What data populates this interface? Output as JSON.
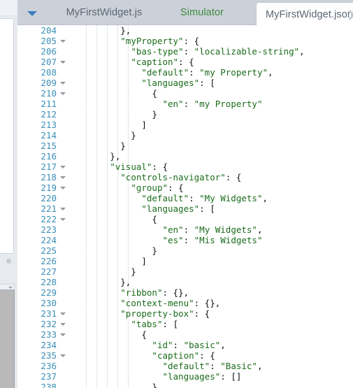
{
  "window": {
    "title": "MyFirstWidget.json"
  },
  "tabbar": {
    "dropdown_icon": "chevron-down-icon",
    "close_icon": "close-icon",
    "tabs": [
      {
        "label": "MyFirstWidget.js",
        "active": false
      },
      {
        "label": "Simulator",
        "active": false
      },
      {
        "label": "MyFirstWidget.json",
        "active": true
      }
    ]
  },
  "colors": {
    "tabbar_background": "#ccd1d9",
    "active_tab_background": "#ffffff",
    "editor_background": "#ffffff",
    "line_number": "#3a8fb7",
    "json_string": "#1a6b1a",
    "punctuation": "#111111",
    "simulator_tab_text": "#3f8a3f",
    "dropdown_caret": "#3a7fc1",
    "fold_marker": "#8f98a1"
  },
  "editor": {
    "language": "json",
    "first_line": 204,
    "last_line": 238,
    "lines": [
      {
        "n": 204,
        "fold": false,
        "text": "          },"
      },
      {
        "n": 205,
        "fold": true,
        "text": "          \"myProperty\": {"
      },
      {
        "n": 206,
        "fold": false,
        "text": "            \"bas-type\": \"localizable-string\","
      },
      {
        "n": 207,
        "fold": true,
        "text": "            \"caption\": {"
      },
      {
        "n": 208,
        "fold": false,
        "text": "              \"default\": \"my Property\","
      },
      {
        "n": 209,
        "fold": true,
        "text": "              \"languages\": ["
      },
      {
        "n": 210,
        "fold": true,
        "text": "                {"
      },
      {
        "n": 211,
        "fold": false,
        "text": "                  \"en\": \"my Property\""
      },
      {
        "n": 212,
        "fold": false,
        "text": "                }"
      },
      {
        "n": 213,
        "fold": false,
        "text": "              ]"
      },
      {
        "n": 214,
        "fold": false,
        "text": "            }"
      },
      {
        "n": 215,
        "fold": false,
        "text": "          }"
      },
      {
        "n": 216,
        "fold": false,
        "text": "        },"
      },
      {
        "n": 217,
        "fold": true,
        "text": "        \"visual\": {"
      },
      {
        "n": 218,
        "fold": true,
        "text": "          \"controls-navigator\": {"
      },
      {
        "n": 219,
        "fold": true,
        "text": "            \"group\": {"
      },
      {
        "n": 220,
        "fold": false,
        "text": "              \"default\": \"My Widgets\","
      },
      {
        "n": 221,
        "fold": true,
        "text": "              \"languages\": ["
      },
      {
        "n": 222,
        "fold": true,
        "text": "                {"
      },
      {
        "n": 223,
        "fold": false,
        "text": "                  \"en\": \"My Widgets\","
      },
      {
        "n": 224,
        "fold": false,
        "text": "                  \"es\": \"Mis Widgets\""
      },
      {
        "n": 225,
        "fold": false,
        "text": "                }"
      },
      {
        "n": 226,
        "fold": false,
        "text": "              ]"
      },
      {
        "n": 227,
        "fold": false,
        "text": "            }"
      },
      {
        "n": 228,
        "fold": false,
        "text": "          },"
      },
      {
        "n": 229,
        "fold": false,
        "text": "          \"ribbon\": {},"
      },
      {
        "n": 230,
        "fold": false,
        "text": "          \"context-menu\": {},"
      },
      {
        "n": 231,
        "fold": true,
        "text": "          \"property-box\": {"
      },
      {
        "n": 232,
        "fold": true,
        "text": "            \"tabs\": ["
      },
      {
        "n": 233,
        "fold": true,
        "text": "              {"
      },
      {
        "n": 234,
        "fold": false,
        "text": "                \"id\": \"basic\","
      },
      {
        "n": 235,
        "fold": true,
        "text": "                \"caption\": {"
      },
      {
        "n": 236,
        "fold": false,
        "text": "                  \"default\": \"Basic\","
      },
      {
        "n": 237,
        "fold": false,
        "text": "                  \"languages\": []"
      },
      {
        "n": 238,
        "fold": false,
        "text": "                },"
      }
    ],
    "indent_guide_columns": [
      10,
      12,
      14,
      16,
      18
    ]
  }
}
